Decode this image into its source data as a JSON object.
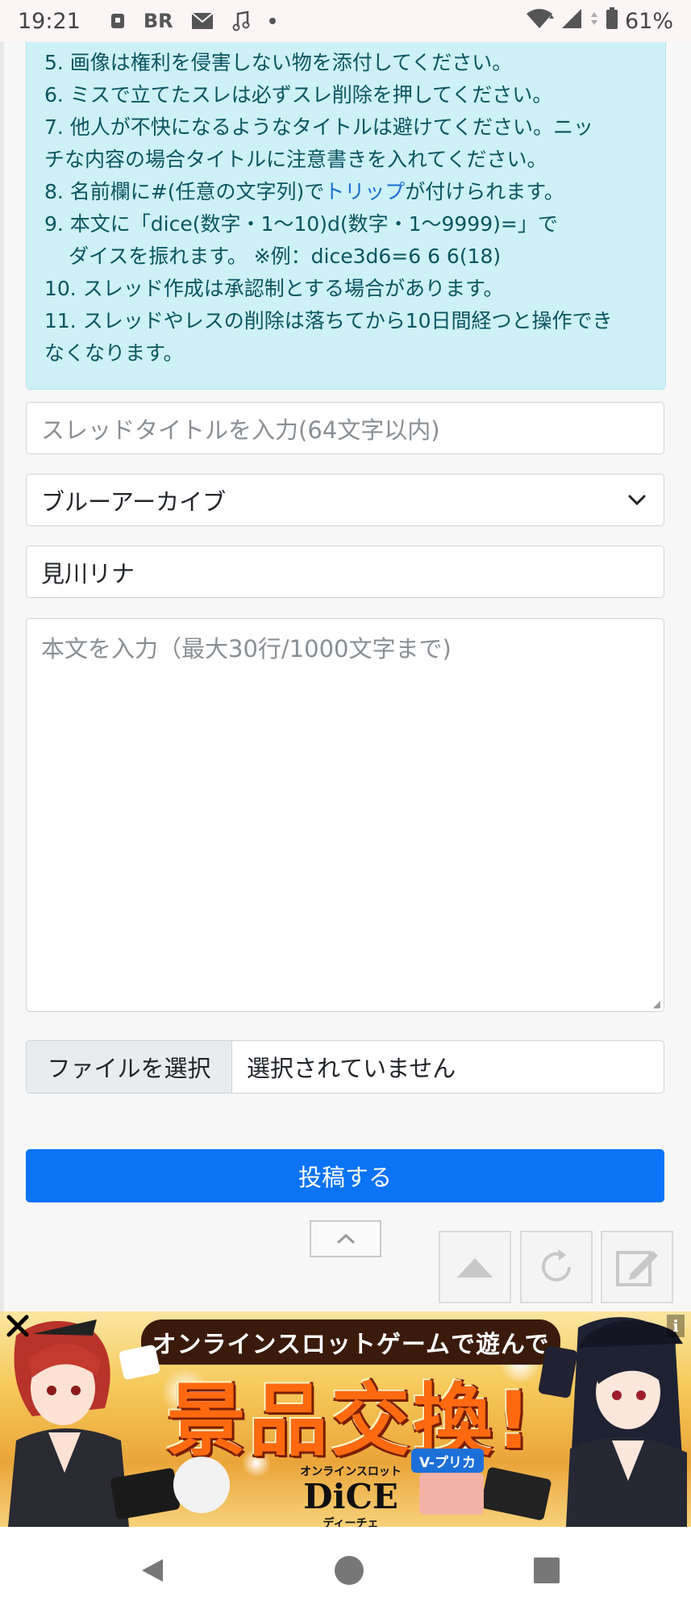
{
  "status_bar": {
    "time": "19:21",
    "battery": "61%",
    "icons": [
      "lock-icon",
      "br-icon",
      "mail-icon",
      "music-icon",
      "dot-icon",
      "wifi-icon",
      "signal-icon",
      "signal-icon",
      "battery-icon"
    ]
  },
  "rules": {
    "r5": "5. 画像は権利を侵害しない物を添付してください。",
    "r6": "6. ミスで立てたスレは必ずスレ削除を押してください。",
    "r7a": "7. 他人が不快になるようなタイトルは避けてください。ニッ",
    "r7b": "チな内容の場合タイトルに注意書きを入れてください。",
    "r8_pre": "8. 名前欄に#(任意の文字列)で",
    "r8_link": "トリップ",
    "r8_post": "が付けられます。",
    "r9a": "9. 本文に「dice(数字・1〜10)d(数字・1〜9999)=」で",
    "r9b": "ダイスを振れます。 ※例：dice3d6=6 6 6(18)",
    "r10": "10. スレッド作成は承認制とする場合があります。",
    "r11a": "11. スレッドやレスの削除は落ちてから10日間経つと操作でき",
    "r11b": "なくなります。"
  },
  "form": {
    "title_placeholder": "スレッドタイトルを入力(64文字以内)",
    "category_selected": "ブルーアーカイブ",
    "name_value": "見川リナ",
    "body_placeholder": "本文を入力（最大30行/1000文字まで)",
    "file_button": "ファイルを選択",
    "file_status": "選択されていません",
    "submit_label": "投稿する"
  },
  "ad": {
    "headline": "オンラインスロットゲームで遊んで",
    "big_text": "景品交換!",
    "brand_small": "オンラインスロット",
    "brand_name": "DiCE",
    "brand_kana": "ディーチェ",
    "vprica": "V-プリカ",
    "info": "i"
  },
  "colors": {
    "rules_bg": "#cdf1f7",
    "rules_text": "#0c5460",
    "submit_bg": "#0b73f5",
    "link": "#1c6fd1"
  }
}
